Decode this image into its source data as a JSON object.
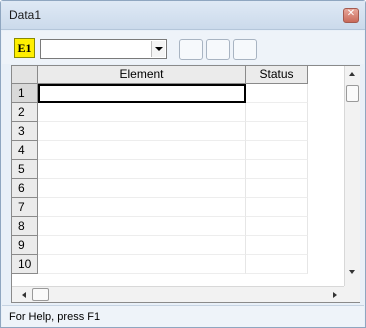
{
  "window": {
    "title": "Data1"
  },
  "toolbar": {
    "element_button_label": "E1",
    "combo_value": "",
    "buttons": [
      "",
      "",
      ""
    ]
  },
  "grid": {
    "columns": [
      "Element",
      "Status"
    ],
    "row_numbers": [
      "1",
      "2",
      "3",
      "4",
      "5",
      "6",
      "7",
      "8",
      "9",
      "10"
    ],
    "selected_row": "1",
    "selected_column": "Element"
  },
  "statusbar": {
    "text": "For Help, press F1"
  },
  "icons": {
    "close": "close-icon",
    "combo_dropdown": "chevron-down-icon",
    "scroll_up": "arrow-up-icon",
    "scroll_down": "arrow-down-icon",
    "scroll_left": "arrow-left-icon",
    "scroll_right": "arrow-right-icon"
  },
  "colors": {
    "element_button_bg": "#ffef00",
    "title_bar": "#cbdaeb",
    "close_button": "#c96a5a"
  }
}
